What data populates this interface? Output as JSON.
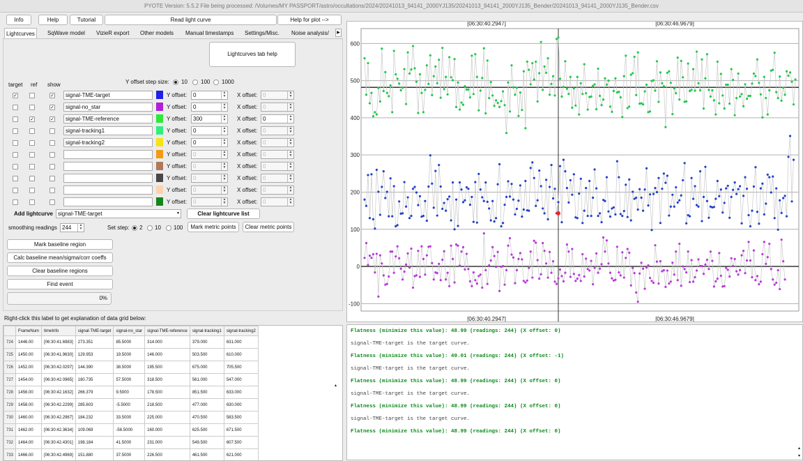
{
  "window": {
    "title": "PYOTE Version: 5.5.2  File being processed: /Volumes/MY PASSPORT/astro/occultations/2024/20241013_94141_2000YJ135/20241013_94141_2000YJ135_Bender/20241013_94141_2000YJ135_Bender.csv"
  },
  "toolbar": {
    "info": "Info",
    "help": "Help",
    "tutorial": "Tutorial",
    "read_light_curve": "Read light curve",
    "help_plot": "Help for plot -->"
  },
  "tabs": [
    "Lightcurves",
    "SqWave model",
    "VizieR export",
    "Other models",
    "Manual timestamps",
    "Settings/Misc.",
    "Noise analysis/"
  ],
  "tab_help_button": "Lightcurves tab help",
  "headers": {
    "target": "target",
    "ref": "ref",
    "show": "show"
  },
  "yoffset_step": {
    "label": "Y offset step size:",
    "options": [
      "10",
      "100",
      "1000"
    ],
    "selected": "10"
  },
  "field_labels": {
    "y_offset": "Y offset:",
    "x_offset": "X offset:"
  },
  "rows": [
    {
      "target": true,
      "ref": false,
      "show": true,
      "name": "signal-TME-target",
      "color": "#1f1fe8",
      "y": "0",
      "x": "0",
      "enabled": true
    },
    {
      "target": false,
      "ref": false,
      "show": true,
      "name": "signal-no_star",
      "color": "#b11fd8",
      "y": "0",
      "x": "0",
      "enabled": true
    },
    {
      "target": false,
      "ref": true,
      "show": true,
      "name": "signal-TME-reference",
      "color": "#2ee83a",
      "y": "300",
      "x": "0",
      "enabled": true
    },
    {
      "target": false,
      "ref": false,
      "show": false,
      "name": "signal-tracking1",
      "color": "#2ef07e",
      "y": "0",
      "x": "0",
      "enabled": true
    },
    {
      "target": false,
      "ref": false,
      "show": false,
      "name": "signal-tracking2",
      "color": "#f5e414",
      "y": "0",
      "x": "0",
      "enabled": true
    },
    {
      "target": false,
      "ref": false,
      "show": false,
      "name": "",
      "color": "#f39a14",
      "y": "0",
      "x": "0",
      "enabled": false
    },
    {
      "target": false,
      "ref": false,
      "show": false,
      "name": "",
      "color": "#b07a5a",
      "y": "0",
      "x": "0",
      "enabled": false
    },
    {
      "target": false,
      "ref": false,
      "show": false,
      "name": "",
      "color": "#474747",
      "y": "0",
      "x": "0",
      "enabled": false
    },
    {
      "target": false,
      "ref": false,
      "show": false,
      "name": "",
      "color": "#fcd3ad",
      "y": "0",
      "x": "0",
      "enabled": false
    },
    {
      "target": false,
      "ref": false,
      "show": false,
      "name": "",
      "color": "#16841a",
      "y": "0",
      "x": "0",
      "enabled": false
    }
  ],
  "add_lightcurve": {
    "label": "Add lightcurve",
    "selected": "signal-TME-target",
    "clear": "Clear lightcurve list"
  },
  "smoothing": {
    "label": "smoothing readings",
    "value": "244"
  },
  "set_step": {
    "label": "Set step:",
    "options": [
      "2",
      "10",
      "100"
    ],
    "selected": "2"
  },
  "buttons": {
    "mark_metric": "Mark metric points",
    "clear_metric": "Clear metric points",
    "mark_baseline": "Mark baseline region",
    "calc_baseline": "Calc baseline mean/sigma/corr coeffs",
    "clear_baseline": "Clear baseline regions",
    "find_event": "Find event"
  },
  "progress": {
    "value": 0,
    "text": "0%"
  },
  "grid_label": "Right-click this label to get explanation of data grid below:",
  "table": {
    "columns": [
      "FrameNum",
      "timeInfo",
      "signal-TME-target",
      "signal-no_star",
      "signal-TME-reference",
      "signal-tracking1",
      "signal-tracking2"
    ],
    "rows": [
      [
        "724",
        "1446.00",
        "[06:30:41.6983]",
        "273.351",
        "85.5000",
        "314.000",
        "379.000",
        "631.000"
      ],
      [
        "725",
        "1450.00",
        "[06:30:41.9630]",
        "129.953",
        "19.5000",
        "146.000",
        "503.500",
        "610.000"
      ],
      [
        "726",
        "1452.00",
        "[06:30:42.0297]",
        "144.390",
        "38.5000",
        "195.500",
        "675.000",
        "705.500"
      ],
      [
        "727",
        "1454.00",
        "[06:30:42.0965]",
        "180.735",
        "57.5000",
        "318.500",
        "561.000",
        "547.000"
      ],
      [
        "728",
        "1456.00",
        "[06:30:42.1632]",
        "266.379",
        "9.5000",
        "178.500",
        "851.500",
        "633.000"
      ],
      [
        "729",
        "1458.00",
        "[06:30:42.2299]",
        "285.603",
        "-5.5000",
        "218.500",
        "477.000",
        "630.000"
      ],
      [
        "730",
        "1460.00",
        "[06:30:42.2967]",
        "184.232",
        "33.5000",
        "225.000",
        "470.500",
        "583.500"
      ],
      [
        "731",
        "1462.00",
        "[06:30:42.3634]",
        "109.069",
        "-56.5000",
        "160.000",
        "625.500",
        "671.500"
      ],
      [
        "732",
        "1464.00",
        "[06:30:42.4301]",
        "198.184",
        "41.5000",
        "231.000",
        "549.500",
        "607.500"
      ],
      [
        "733",
        "1466.00",
        "[06:30:42.4969]",
        "151.880",
        "37.5000",
        "226.500",
        "461.500",
        "621.000"
      ]
    ]
  },
  "log": [
    {
      "text": "Flatness (minimize this value): 48.99 (readings: 244) (X offset: 0)",
      "kind": "flat"
    },
    {
      "text": "signal-TME-target is the target curve.",
      "kind": "note"
    },
    {
      "text": "Flatness (minimize this value): 49.01 (readings: 244) (X offset: -1)",
      "kind": "flat"
    },
    {
      "text": "signal-TME-target is the target curve.",
      "kind": "note"
    },
    {
      "text": "Flatness (minimize this value): 48.99 (readings: 244) (X offset: 0)",
      "kind": "flat"
    },
    {
      "text": "signal-TME-target is the target curve.",
      "kind": "note"
    },
    {
      "text": "Flatness (minimize this value): 48.99 (readings: 244) (X offset: 0)",
      "kind": "flat"
    },
    {
      "text": "signal-TME-target is the target curve.",
      "kind": "note"
    },
    {
      "text": "Flatness (minimize this value): 48.99 (readings: 244) (X offset: 0)",
      "kind": "flat"
    }
  ],
  "chart_data": {
    "type": "scatter",
    "top_time_labels": [
      "[06:30:40.2947]",
      "[06:30:46.9679]"
    ],
    "bottom_time_labels": [
      "[06:30:40.2947]",
      "[06:30:46.9679]"
    ],
    "ylim": [
      -120,
      640
    ],
    "yticks": [
      -100,
      0,
      100,
      200,
      300,
      400,
      500,
      600
    ],
    "grid": true,
    "reference_line_y": 482,
    "cursor_index": 112,
    "highlight_point": {
      "index": 112,
      "value": 143,
      "color": "#ff2020"
    },
    "series": [
      {
        "name": "signal-TME-reference",
        "color": "#22c84a",
        "values": [
          560,
          462,
          547,
          439,
          467,
          404,
          415,
          409,
          480,
          444,
          586,
          472,
          523,
          467,
          458,
          487,
          415,
          580,
          517,
          505,
          492,
          474,
          481,
          531,
          437,
          576,
          519,
          530,
          593,
          533,
          497,
          413,
          517,
          467,
          415,
          475,
          541,
          491,
          568,
          461,
          512,
          538,
          493,
          556,
          454,
          588,
          477,
          510,
          463,
          563,
          509,
          501,
          558,
          429,
          495,
          422,
          441,
          435,
          485,
          476,
          476,
          455,
          567,
          464,
          571,
          510,
          420,
          473,
          507,
          587,
          412,
          554,
          453,
          496,
          460,
          432,
          447,
          440,
          429,
          445,
          471,
          434,
          359,
          495,
          417,
          541,
          482,
          462,
          481,
          405,
          468,
          421,
          525,
          372,
          551,
          529,
          490,
          547,
          503,
          551,
          444,
          520,
          604,
          475,
          538,
          521,
          560,
          462,
          491,
          512,
          460,
          612,
          616,
          505,
          457,
          483,
          552,
          478,
          464,
          510,
          427,
          479,
          433,
          510,
          409,
          493,
          464,
          544,
          466,
          422,
          456,
          457,
          486,
          490,
          423,
          532,
          459,
          434,
          449,
          506,
          489,
          500,
          430,
          416,
          472,
          506,
          468,
          470,
          455,
          402,
          512,
          567,
          426,
          430,
          516,
          520,
          564,
          461,
          576,
          438,
          439,
          436,
          471,
          489,
          415,
          417,
          499,
          501,
          473,
          552,
          443,
          522,
          493,
          485,
          375,
          521,
          525,
          494,
          410,
          479,
          466,
          562,
          449,
          553,
          509,
          443,
          444,
          546,
          472,
          475,
          531,
          473,
          578,
          493,
          474,
          557,
          425,
          506,
          571,
          475,
          457,
          474,
          447,
          409,
          551,
          439,
          518,
          460,
          425,
          489,
          489,
          438,
          531,
          502,
          407,
          453,
          519,
          457,
          464,
          431,
          490,
          451,
          459,
          459,
          492,
          519,
          512,
          557,
          494,
          463,
          401,
          510,
          453,
          409,
          474,
          527,
          529,
          575,
          469,
          453,
          511,
          446,
          481,
          462,
          525,
          513,
          522,
          497,
          436,
          503
        ]
      },
      {
        "name": "signal-TME-target",
        "color": "#2242c8",
        "values": [
          180,
          163,
          246,
          130,
          248,
          127,
          102,
          260,
          201,
          139,
          214,
          256,
          184,
          201,
          135,
          237,
          135,
          216,
          108,
          111,
          175,
          142,
          143,
          227,
          161,
          186,
          130,
          136,
          209,
          214,
          199,
          165,
          189,
          134,
          136,
          176,
          123,
          215,
          299,
          223,
          158,
          257,
          137,
          273,
          215,
          155,
          171,
          150,
          181,
          188,
          124,
          226,
          100,
          180,
          109,
          226,
          207,
          173,
          178,
          213,
          209,
          166,
          187,
          120,
          227,
          118,
          249,
          207,
          186,
          176,
          226,
          174,
          156,
          124,
          176,
          121,
          130,
          221,
          275,
          108,
          117,
          166,
          187,
          229,
          188,
          222,
          180,
          140,
          155,
          177,
          218,
          134,
          153,
          230,
          151,
          150,
          265,
          280,
          238,
          163,
          178,
          258,
          216,
          156,
          143,
          233,
          127,
          214,
          273,
          183,
          209,
          143,
          173,
          270,
          119,
          287,
          256,
          211,
          172,
          232,
          193,
          248,
          132,
          130,
          196,
          236,
          117,
          150,
          211,
          136,
          230,
          136,
          185,
          261,
          210,
          136,
          143,
          119,
          179,
          176,
          240,
          148,
          134,
          156,
          159,
          140,
          283,
          240,
          141,
          136,
          149,
          220,
          133,
          234,
          124,
          201,
          182,
          185,
          153,
          208,
          185,
          150,
          207,
          264,
          164,
          194,
          98,
          195,
          211,
          200,
          238,
          117,
          209,
          250,
          225,
          244,
          137,
          161,
          193,
          161,
          213,
          172,
          178,
          191,
          232,
          278,
          116,
          138,
          135,
          238,
          182,
          216,
          165,
          161,
          256,
          122,
          187,
          268,
          176,
          131,
          161,
          159,
          160,
          182,
          230,
          189,
          207,
          145,
          171,
          210,
          217,
          131,
          187,
          206,
          226,
          195,
          208,
          216,
          116,
          190,
          240,
          209,
          138,
          108,
          150,
          215,
          267,
          147,
          115,
          210,
          223,
          140,
          169,
          247,
          240,
          199,
          242,
          130,
          210,
          99,
          178,
          144,
          184,
          190,
          135,
          295,
          351,
          175,
          287
        ]
      },
      {
        "name": "signal-no_star",
        "color": "#b83ad8",
        "values": [
          23,
          63,
          4,
          29,
          23,
          33,
          -16,
          34,
          -81,
          30,
          8,
          -24,
          -49,
          -47,
          -27,
          40,
          40,
          -17,
          27,
          54,
          22,
          -6,
          -35,
          -14,
          5,
          35,
          -3,
          48,
          -57,
          -26,
          -24,
          42,
          -28,
          54,
          20,
          -22,
          30,
          53,
          54,
          9,
          -35,
          -16,
          -18,
          7,
          -37,
          18,
          41,
          -35,
          -17,
          -53,
          56,
          20,
          -43,
          59,
          56,
          2,
          40,
          52,
          -8,
          34,
          -7,
          -40,
          -53,
          -16,
          -37,
          -46,
          -26,
          -22,
          -57,
          89,
          -10,
          -47,
          3,
          16,
          52,
          28,
          -1,
          39,
          -66,
          -1,
          1,
          -49,
          -10,
          56,
          76,
          32,
          24,
          -45,
          -10,
          20,
          36,
          19,
          -39,
          -43,
          -38,
          -4,
          40,
          -30,
          69,
          64,
          17,
          -33,
          -21,
          63,
          42,
          8,
          -30,
          39,
          -17,
          14,
          -41,
          -47,
          -32,
          -8,
          -26,
          -40,
          -17,
          59,
          40,
          -28,
          47,
          -20,
          -39,
          -33,
          -23,
          -39,
          33,
          -27,
          21,
          -7,
          -11,
          15,
          -48,
          -4,
          35,
          -17,
          -6,
          6,
          78,
          40,
          70,
          8,
          -17,
          -32,
          -38,
          -36,
          53,
          -16,
          -24,
          38,
          -30,
          23,
          47,
          37,
          -51,
          -4,
          -18,
          -70,
          -95,
          -19,
          10,
          -6,
          -60,
          -3,
          3,
          -31,
          -39,
          -44,
          57,
          13,
          -46,
          14,
          -13,
          -10,
          -55,
          -11,
          -46,
          -41,
          10,
          -22,
          40,
          -37,
          61,
          -52,
          0,
          -7,
          -16,
          40,
          -42,
          17,
          -41,
          -29,
          -11,
          19,
          1,
          1,
          -20,
          5,
          18,
          -7,
          40,
          15,
          -54,
          -40,
          -33,
          36,
          -25,
          -54,
          -53,
          -4,
          -9,
          -27,
          22,
          1,
          20,
          -13,
          -22,
          -10,
          30,
          42,
          -18,
          16,
          66,
          16,
          -29,
          43,
          -37,
          -26,
          -48,
          -41,
          33,
          66,
          7,
          25,
          61,
          -7,
          -35,
          -49,
          -44,
          -10,
          -61,
          72,
          14,
          -35
        ]
      }
    ]
  }
}
